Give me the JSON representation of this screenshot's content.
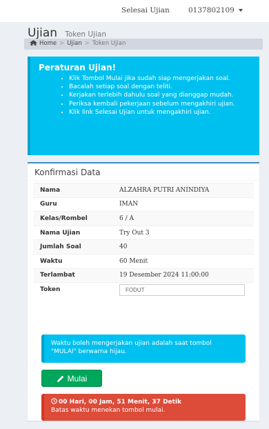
{
  "topbar": {
    "logout_label": "Selesai Ujian",
    "user_label": "0137802109"
  },
  "header": {
    "title": "Ujian",
    "subtitle": "Token Ujian"
  },
  "breadcrumb": {
    "home": "Home",
    "ujian": "Ujian",
    "current": "Token Ujian"
  },
  "rules": {
    "title": "Peraturan Ujian!",
    "items": [
      "Klik Tombol Mulai jika sudah siap mengerjakan soal.",
      "Bacalah setiap soal dengan teliti.",
      "Kerjakan terlebih dahulu soal yang dianggap mudah.",
      "Periksa kembali pekerjaan sebelum mengakhiri ujian.",
      "Klik link Selesai Ujian untuk mengakhiri ujian."
    ]
  },
  "confirm": {
    "title": "Konfirmasi Data",
    "rows": [
      {
        "label": "Nama",
        "value": "ALZAHRA PUTRI ANINDIYA"
      },
      {
        "label": "Guru",
        "value": "IMAN"
      },
      {
        "label": "Kelas/Rombel",
        "value": "6 / A"
      },
      {
        "label": "Nama Ujian",
        "value": "Try Out 3"
      },
      {
        "label": "Jumlah Soal",
        "value": "40"
      },
      {
        "label": "Waktu",
        "value": "60 Menit"
      },
      {
        "label": "Terlambat",
        "value": "19 Desember 2024 11:00:00"
      }
    ],
    "token_label": "Token",
    "token_value": "FODUT"
  },
  "info_text": "Waktu boleh mengerjakan ujian adalah saat tombol \"MULAI\" berwarna hijau.",
  "start_button": "Mulai",
  "countdown": {
    "time": "00 Hari, 00 Jam, 51 Menit, 37 Detik",
    "note": "Batas waktu menekan tombol mulai."
  },
  "colors": {
    "info": "#00c0ef",
    "success": "#00a65a",
    "danger": "#dd4b39",
    "primary": "#3c8dbc"
  },
  "icons": [
    "home-icon",
    "caret-down-icon",
    "pencil-icon",
    "clock-icon"
  ]
}
